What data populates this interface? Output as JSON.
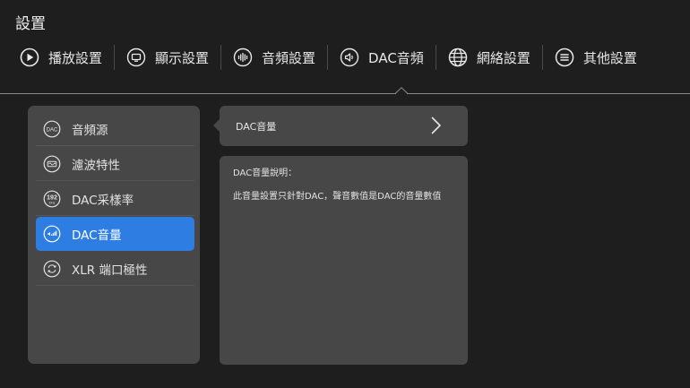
{
  "header": {
    "title": "設置"
  },
  "tabs": [
    {
      "label": "播放設置",
      "icon": "play-icon"
    },
    {
      "label": "顯示設置",
      "icon": "monitor-icon"
    },
    {
      "label": "音頻設置",
      "icon": "audio-wave-icon"
    },
    {
      "label": "DAC音頻",
      "icon": "speaker-icon"
    },
    {
      "label": "網絡設置",
      "icon": "globe-icon"
    },
    {
      "label": "其他設置",
      "icon": "menu-icon"
    }
  ],
  "active_tab": "DAC音頻",
  "sidebar": {
    "items": [
      {
        "label": "音頻源",
        "icon": "dac-icon",
        "icon_text": "DAC"
      },
      {
        "label": "濾波特性",
        "icon": "filter-icon"
      },
      {
        "label": "DAC采樣率",
        "icon": "sample-rate-icon",
        "icon_text": "192",
        "icon_subtext": "KHz"
      },
      {
        "label": "DAC音量",
        "icon": "volume-icon"
      },
      {
        "label": "XLR 端口極性",
        "icon": "polarity-icon"
      }
    ],
    "active_item": "DAC音量"
  },
  "detail": {
    "setting_label": "DAC音量",
    "description_title": "DAC音量說明：",
    "description_text": "此音量設置只針對DAC，聲音數值是DAC的音量數值"
  },
  "colors": {
    "background": "#1e1e1e",
    "panel": "#474747",
    "accent": "#2d7de3",
    "text": "#e6e6e6"
  }
}
